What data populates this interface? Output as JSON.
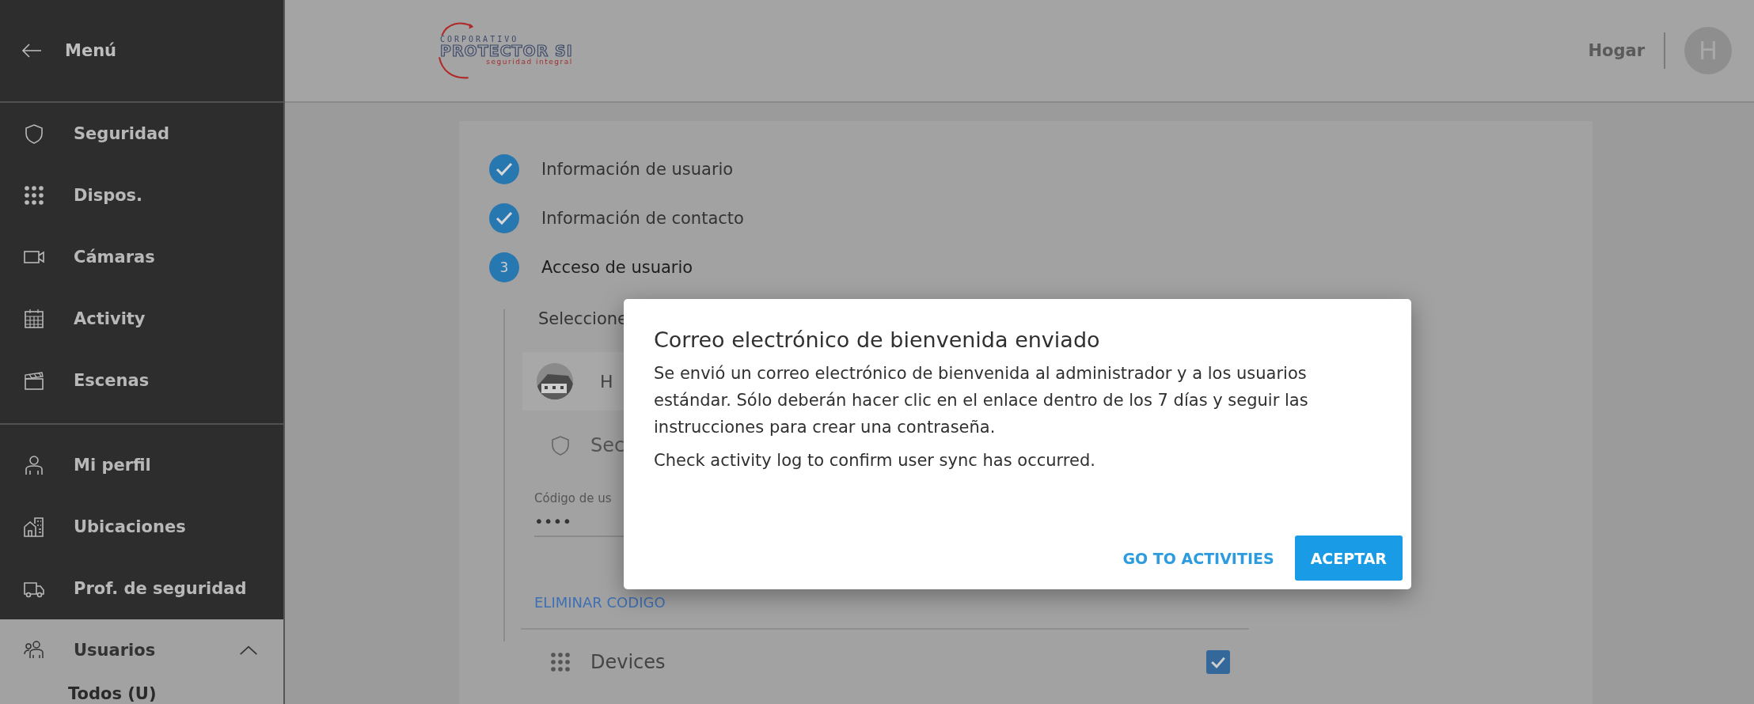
{
  "sidebar": {
    "back_label": "Menú",
    "groups": [
      [
        {
          "label": "Seguridad",
          "selected": false
        },
        {
          "label": "Dispos.",
          "selected": false
        },
        {
          "label": "Cámaras",
          "selected": false
        },
        {
          "label": "Activity",
          "selected": false
        },
        {
          "label": "Escenas",
          "selected": false
        }
      ],
      [
        {
          "label": "Mi perfil",
          "selected": false
        },
        {
          "label": "Ubicaciones",
          "selected": false
        },
        {
          "label": "Prof. de seguridad",
          "selected": false
        },
        {
          "label": "Usuarios",
          "selected": true,
          "expanded": true,
          "children": [
            {
              "label": "Todos (U)"
            }
          ]
        }
      ]
    ]
  },
  "header": {
    "logo": {
      "top": "CORPORATIVO",
      "name": "PROTECTOR SI",
      "tagline": "seguridad integral"
    },
    "location": "Hogar",
    "avatar": "H"
  },
  "stepper": {
    "steps": [
      {
        "label": "Información de usuario",
        "done": true
      },
      {
        "label": "Información de contacto",
        "done": true
      },
      {
        "label": "Acceso de usuario",
        "done": false,
        "number": "3"
      }
    ],
    "prompt": "Seleccione",
    "user_row": {
      "name": "H"
    },
    "section": {
      "label": "Sec"
    },
    "code_field": {
      "label": "Código de us",
      "value": "••••"
    },
    "remove_link": "ELIMINAR CODIGO",
    "permissions": [
      {
        "label": "Devices",
        "checked": true
      }
    ]
  },
  "dialog": {
    "title": "Correo electrónico de bienvenida enviado",
    "paragraphs": [
      "Se envió un correo electrónico de bienvenida al administrador y a los usuarios estándar. Sólo deberán hacer clic en el enlace dentro de los 7 días y seguir las instrucciones para crear una contraseña.",
      "Check activity log to confirm user sync has occurred."
    ],
    "buttons": [
      {
        "label": "GO TO ACTIVITIES",
        "kind": "text"
      },
      {
        "label": "ACEPTAR",
        "kind": "primary"
      }
    ]
  }
}
